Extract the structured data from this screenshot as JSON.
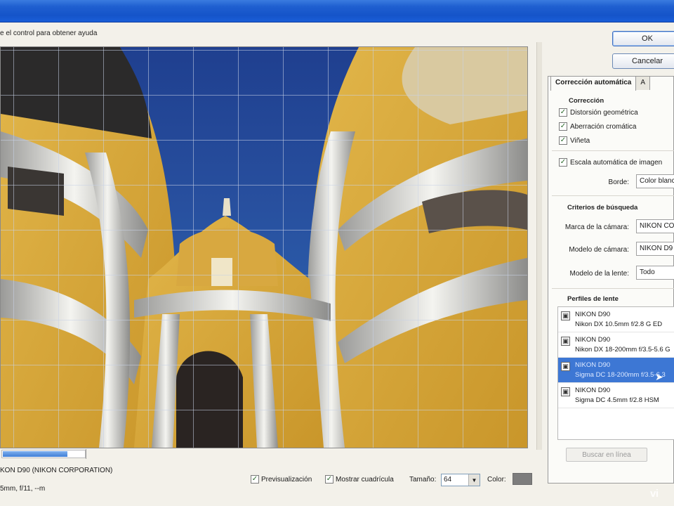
{
  "dialog": {
    "hint": "e el control para obtener ayuda"
  },
  "buttons": {
    "ok_label": "OK",
    "cancel_label": "Cancelar"
  },
  "tabs": [
    {
      "label": "Corrección automática",
      "active": true
    },
    {
      "label": "A",
      "active": false
    }
  ],
  "correction": {
    "title": "Corrección",
    "options": [
      {
        "label": "Distorsión geométrica",
        "checked": true
      },
      {
        "label": "Aberración cromática",
        "checked": true
      },
      {
        "label": "Viñeta",
        "checked": true
      }
    ],
    "auto_scale": {
      "label": "Escala automática de imagen",
      "checked": true
    },
    "border_label": "Borde:",
    "border_value": "Color blanc"
  },
  "search_criteria": {
    "title": "Criterios de búsqueda",
    "camera_make_label": "Marca de la cámara:",
    "camera_make_value": "NIKON CO",
    "camera_model_label": "Modelo de cámara:",
    "camera_model_value": "NIKON D9",
    "lens_model_label": "Modelo de la lente:",
    "lens_model_value": "Todo"
  },
  "lens_profiles": {
    "title": "Perfiles de lente",
    "items": [
      {
        "camera": "NIKON D90",
        "lens": "Nikon DX 10.5mm f/2.8 G ED",
        "selected": false
      },
      {
        "camera": "NIKON D90",
        "lens": "Nikon DX 18-200mm f/3.5-5.6 G",
        "selected": false
      },
      {
        "camera": "NIKON D90",
        "lens": "Sigma DC 18-200mm f/3.5-6.3",
        "selected": true
      },
      {
        "camera": "NIKON D90",
        "lens": "Sigma DC 4.5mm f/2.8 HSM",
        "selected": false
      }
    ],
    "search_online_label": "Buscar en línea"
  },
  "status": {
    "line1": "KON D90 (NIKON CORPORATION)",
    "line2": "5mm, f/11, --m"
  },
  "controls": {
    "preview_label": "Previsualización",
    "preview_checked": true,
    "show_grid_label": "Mostrar cuadrícula",
    "show_grid_checked": true,
    "size_label": "Tamaño:",
    "size_value": "64",
    "color_label": "Color:"
  },
  "progress": {
    "fraction": 0.78
  },
  "colors": {
    "grid_swatch": "#7d7d7d",
    "selection": "#3d77d4"
  },
  "watermark": "vi"
}
